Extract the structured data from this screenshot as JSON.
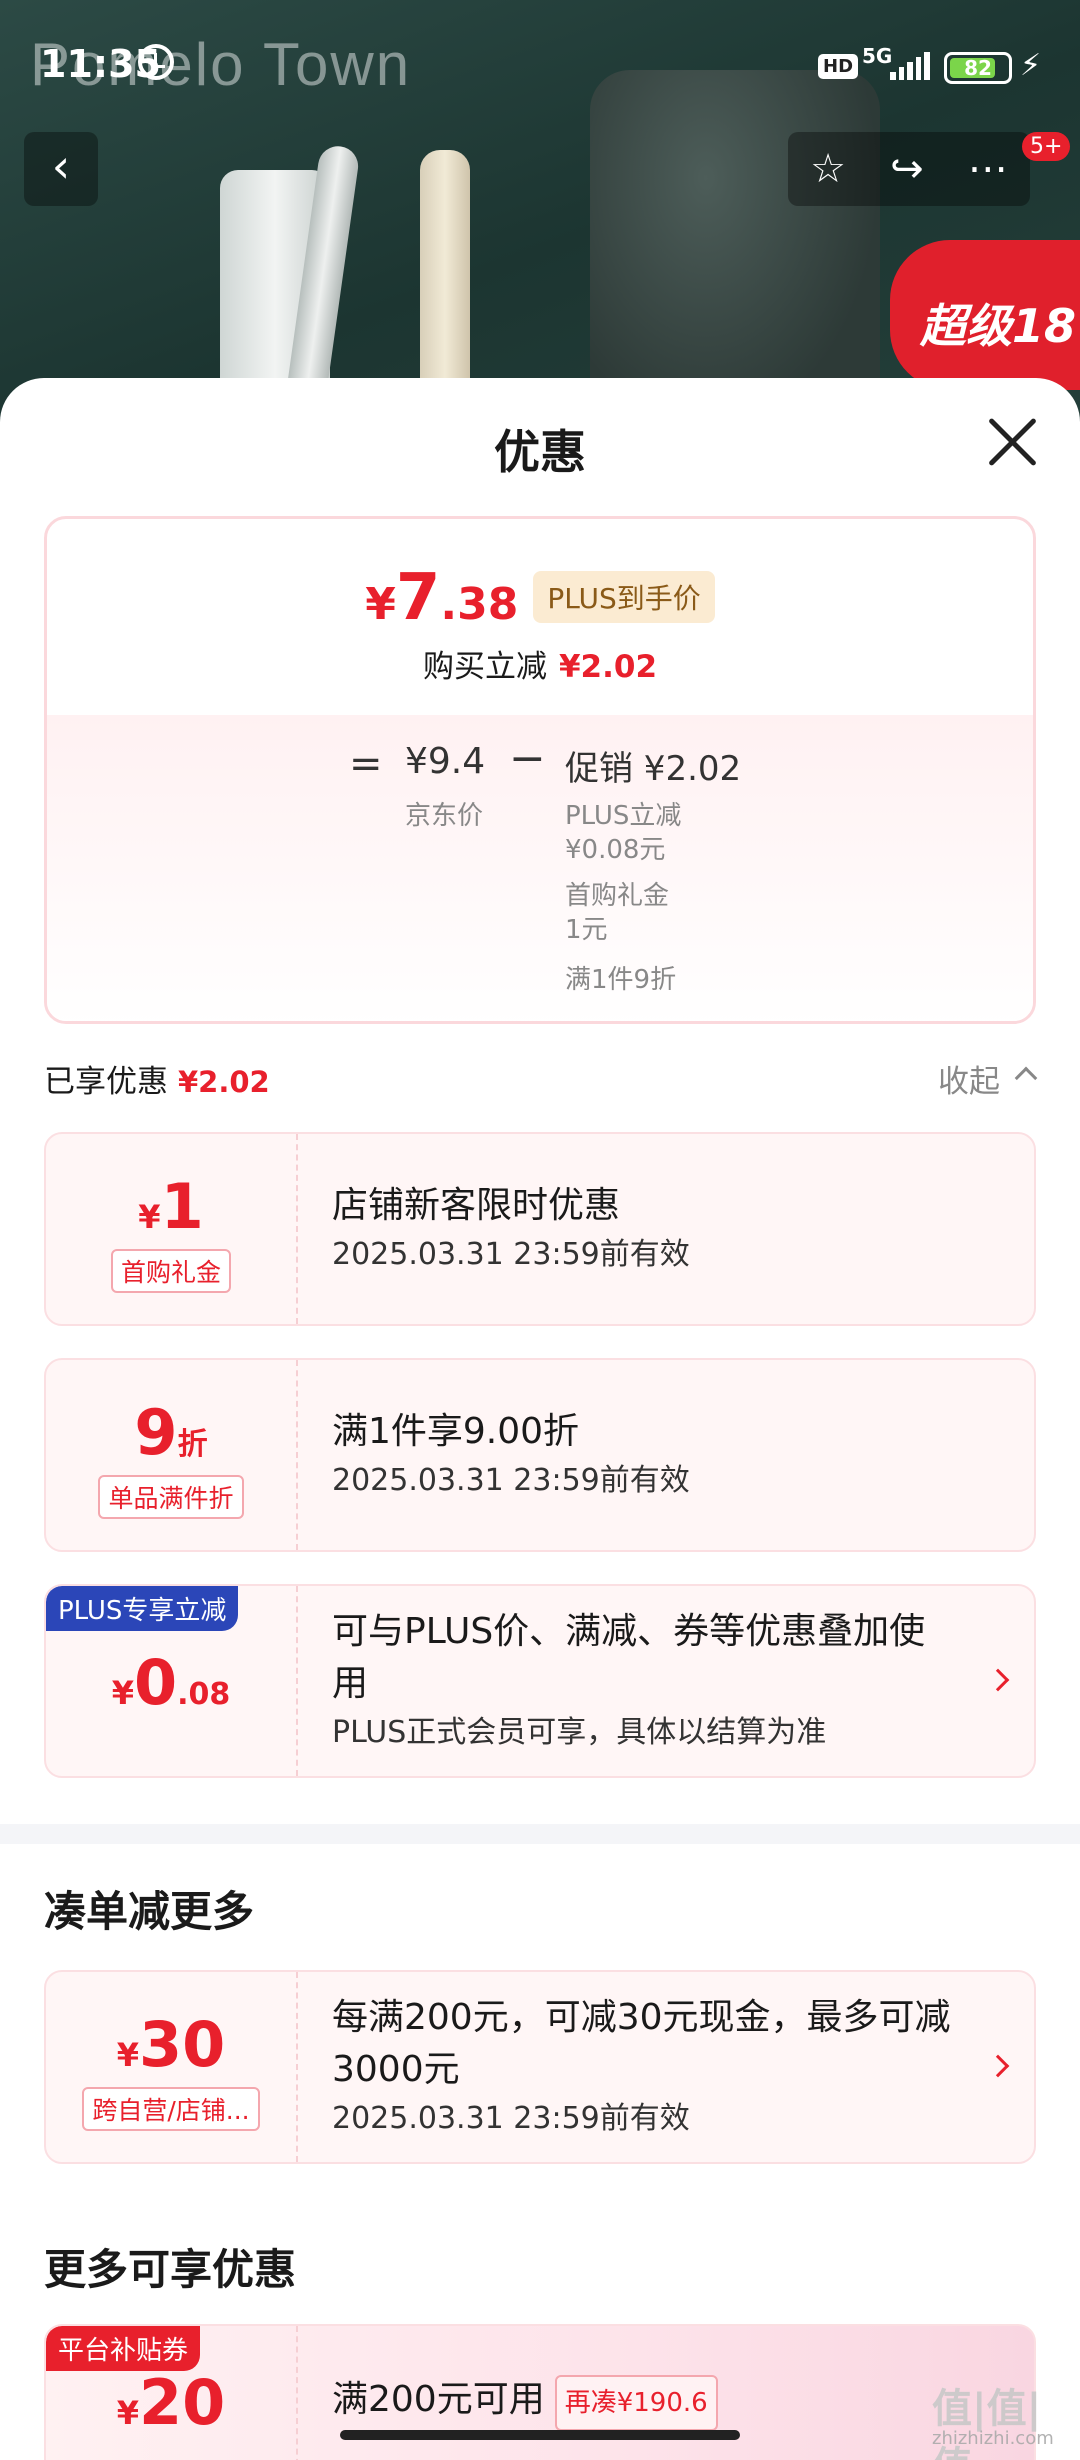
{
  "status_bar": {
    "time": "11:35",
    "network": "5G",
    "battery": "82",
    "battery_level": 0.82
  },
  "hero": {
    "brand_watermark": "Pomelo Town",
    "promo_tag": "超级18",
    "cart_badge": "5+"
  },
  "sheet": {
    "title": "优惠"
  },
  "price_summary": {
    "currency": "¥",
    "final_int": "7",
    "final_dec": ".38",
    "plus_tag": "PLUS到手价",
    "reduce_label": "购买立减",
    "reduce_amount": "¥2.02",
    "equals": "=",
    "jd_price": "¥9.4",
    "jd_label": "京东价",
    "minus": "−",
    "promo_head": "促销 ¥2.02",
    "promo_lines": [
      "PLUS立减",
      "¥0.08元",
      "首购礼金",
      "1元",
      "满1件9折"
    ]
  },
  "enjoyed": {
    "label": "已享优惠",
    "amount": "¥2.02",
    "collapse": "收起"
  },
  "coupons": [
    {
      "sym": "¥",
      "big": "1",
      "small": "",
      "type": "首购礼金",
      "title": "店铺新客限时优惠",
      "sub": "2025.03.31 23:59前有效",
      "corner": ""
    },
    {
      "sym": "",
      "big": "9",
      "small": "折",
      "type": "单品满件折",
      "title": "满1件享9.00折",
      "sub": "2025.03.31 23:59前有效",
      "corner": ""
    },
    {
      "sym": "¥",
      "big": "0",
      "small": ".08",
      "type": "",
      "title": "可与PLUS价、满减、券等优惠叠加使用",
      "sub": "PLUS正式会员可享，具体以结算为准",
      "corner": "PLUS专享立减"
    }
  ],
  "section_more_order": {
    "title": "凑单减更多",
    "coupon": {
      "sym": "¥",
      "big": "30",
      "type": "跨自营/店铺...",
      "title": "每满200元，可减30元现金，最多可减3000元",
      "sub": "2025.03.31 23:59前有效"
    }
  },
  "section_more_deals": {
    "title": "更多可享优惠",
    "coupon": {
      "sym": "¥",
      "big": "20",
      "corner": "平台补贴券",
      "title": "满200元可用",
      "stack_tag": "再凑¥190.6"
    }
  },
  "watermark": {
    "main": "值|值|值",
    "sub": "zhizhizhi.com"
  },
  "colors": {
    "accent": "#e8202c",
    "plus_blue": "#2b46b8"
  }
}
